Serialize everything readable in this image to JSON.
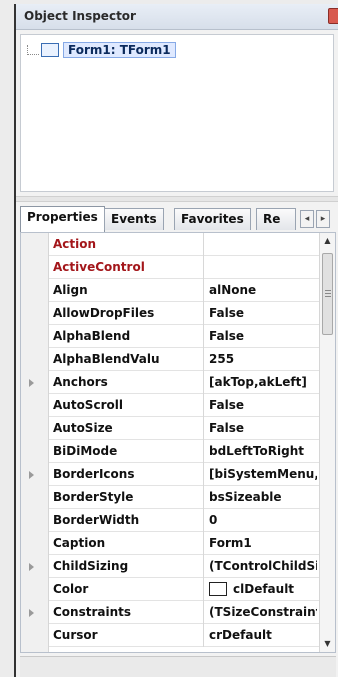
{
  "window": {
    "title": "Object Inspector"
  },
  "tree": {
    "root_label": "Form1: TForm1"
  },
  "tabs": [
    {
      "label": "Properties",
      "active": true
    },
    {
      "label": "Events",
      "active": false
    },
    {
      "label": "Favorites",
      "active": false
    },
    {
      "label": "Re",
      "active": false
    }
  ],
  "tab_scroll": {
    "left_glyph": "◂",
    "right_glyph": "▸"
  },
  "properties": [
    {
      "name": "Action",
      "value": "",
      "expandable": false,
      "style": "event-ref"
    },
    {
      "name": "ActiveControl",
      "value": "",
      "expandable": false,
      "style": "event-ref"
    },
    {
      "name": "Align",
      "value": "alNone",
      "expandable": false,
      "style": "normal"
    },
    {
      "name": "AllowDropFiles",
      "value": "False",
      "expandable": false,
      "style": "normal"
    },
    {
      "name": "AlphaBlend",
      "value": "False",
      "expandable": false,
      "style": "normal"
    },
    {
      "name": "AlphaBlendValu",
      "value": "255",
      "expandable": false,
      "style": "normal"
    },
    {
      "name": "Anchors",
      "value": "[akTop,akLeft]",
      "expandable": true,
      "style": "normal"
    },
    {
      "name": "AutoScroll",
      "value": "False",
      "expandable": false,
      "style": "normal"
    },
    {
      "name": "AutoSize",
      "value": "False",
      "expandable": false,
      "style": "normal"
    },
    {
      "name": "BiDiMode",
      "value": "bdLeftToRight",
      "expandable": false,
      "style": "normal"
    },
    {
      "name": "BorderIcons",
      "value": "[biSystemMenu,l",
      "expandable": true,
      "style": "normal"
    },
    {
      "name": "BorderStyle",
      "value": "bsSizeable",
      "expandable": false,
      "style": "normal"
    },
    {
      "name": "BorderWidth",
      "value": "0",
      "expandable": false,
      "style": "normal"
    },
    {
      "name": "Caption",
      "value": "Form1",
      "expandable": false,
      "style": "normal"
    },
    {
      "name": "ChildSizing",
      "value": "(TControlChildSi",
      "expandable": true,
      "style": "normal"
    },
    {
      "name": "Color",
      "value": "clDefault",
      "expandable": false,
      "style": "normal",
      "swatch": "#ffffff"
    },
    {
      "name": "Constraints",
      "value": "(TSizeConstraints",
      "expandable": true,
      "style": "normal"
    },
    {
      "name": "Cursor",
      "value": "crDefault",
      "expandable": false,
      "style": "normal"
    }
  ],
  "colors": {
    "event_ref": "#a3161a",
    "tree_highlight": "#dfe9ff",
    "close": "#d85a4f"
  }
}
